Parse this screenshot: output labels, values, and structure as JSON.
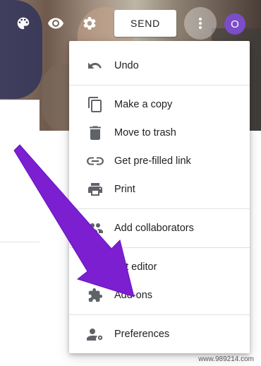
{
  "toolbar": {
    "send_label": "SEND",
    "avatar_initial": "O",
    "icons": [
      "palette-icon",
      "eye-icon",
      "gear-icon",
      "more-vert-icon"
    ]
  },
  "menu": {
    "items": [
      {
        "label": "Undo",
        "icon": "undo-icon"
      },
      {
        "label": "Make a copy",
        "icon": "copy-icon"
      },
      {
        "label": "Move to trash",
        "icon": "trash-icon"
      },
      {
        "label": "Get pre-filled link",
        "icon": "link-icon"
      },
      {
        "label": "Print",
        "icon": "print-icon"
      },
      {
        "label": "Add collaborators",
        "icon": "people-icon"
      },
      {
        "label": "ript editor",
        "icon": "code-icon"
      },
      {
        "label": "Add-ons",
        "icon": "puzzle-icon"
      },
      {
        "label": "Preferences",
        "icon": "person-settings-icon"
      }
    ]
  },
  "colors": {
    "arrow": "#7b1fd0",
    "avatar": "#7b4dc9",
    "icon": "#5f6368"
  },
  "watermark": "www.989214.com"
}
